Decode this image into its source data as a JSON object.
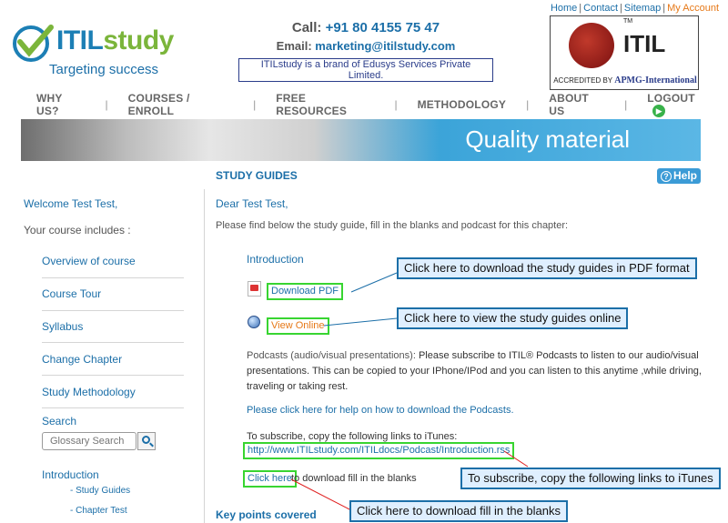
{
  "header": {
    "logo": {
      "brand_main": "ITIL",
      "brand_accent": "study",
      "tagline": "Targeting success"
    },
    "call_label": "Call:",
    "call_number": "+91 80 4155 75 47",
    "email_label": "Email:",
    "email": "marketing@itilstudy.com",
    "brand_note": "ITILstudy is a brand of Edusys Services Private Limited.",
    "top_links": [
      "Home",
      "Contact",
      "Sitemap",
      "My Account"
    ],
    "itil_badge": {
      "word": "ITIL",
      "tm": "TM",
      "accredited": "ACCREDITED BY",
      "org": "APMG-International"
    }
  },
  "nav": [
    "WHY US?",
    "COURSES / ENROLL",
    "FREE RESOURCES",
    "METHODOLOGY",
    "ABOUT US",
    "LOGOUT"
  ],
  "banner": {
    "title": "Quality material"
  },
  "section": {
    "title": "STUDY GUIDES",
    "help": "Help"
  },
  "sidebar": {
    "welcome": "Welcome Test Test,",
    "includes": "Your course includes :",
    "links": [
      "Overview of course",
      "Course Tour",
      "Syllabus",
      "Change Chapter",
      "Study Methodology"
    ],
    "search_label": "Search",
    "search_placeholder": "Glossary Search",
    "chapter": "Introduction",
    "sub_links": [
      "- Study Guides",
      "- Chapter Test"
    ]
  },
  "main": {
    "greeting": "Dear Test Test,",
    "intro": "Please find below the study guide, fill in the blanks and podcast for this chapter:",
    "chapter_title": "Introduction",
    "download_pdf": "Download PDF",
    "view_online": "View Online",
    "podcasts_label": "Podcasts (audio/visual presentations):",
    "podcasts_text": " Please subscribe to ITIL® Podcasts to listen to our audio/visual presentations. This can be copied to your IPhone/IPod and you can listen to this anytime ,while driving, traveling or taking rest.",
    "podcast_help": "Please click here for help on how to download the Podcasts.",
    "subscribe_label": "To subscribe, copy the following links to iTunes:",
    "rss_link": "http://www.ITILstudy.com/ITILdocs/Podcast/Introduction.rss",
    "click_here": "Click here",
    "fill_text": "to download fill in the blanks",
    "key_points": "Key points covered"
  },
  "callouts": {
    "pdf": "Click here to download the study guides in PDF format",
    "online": "Click here to view the study guides online",
    "itunes": "To subscribe, copy the following links to iTunes",
    "fill": "Click here to download fill in the blanks"
  },
  "colors": {
    "link": "#1c6fa8",
    "highlight": "#38d531",
    "callout_bg": "#dfefff",
    "banner": "#2a8fca",
    "orange": "#e67817"
  }
}
